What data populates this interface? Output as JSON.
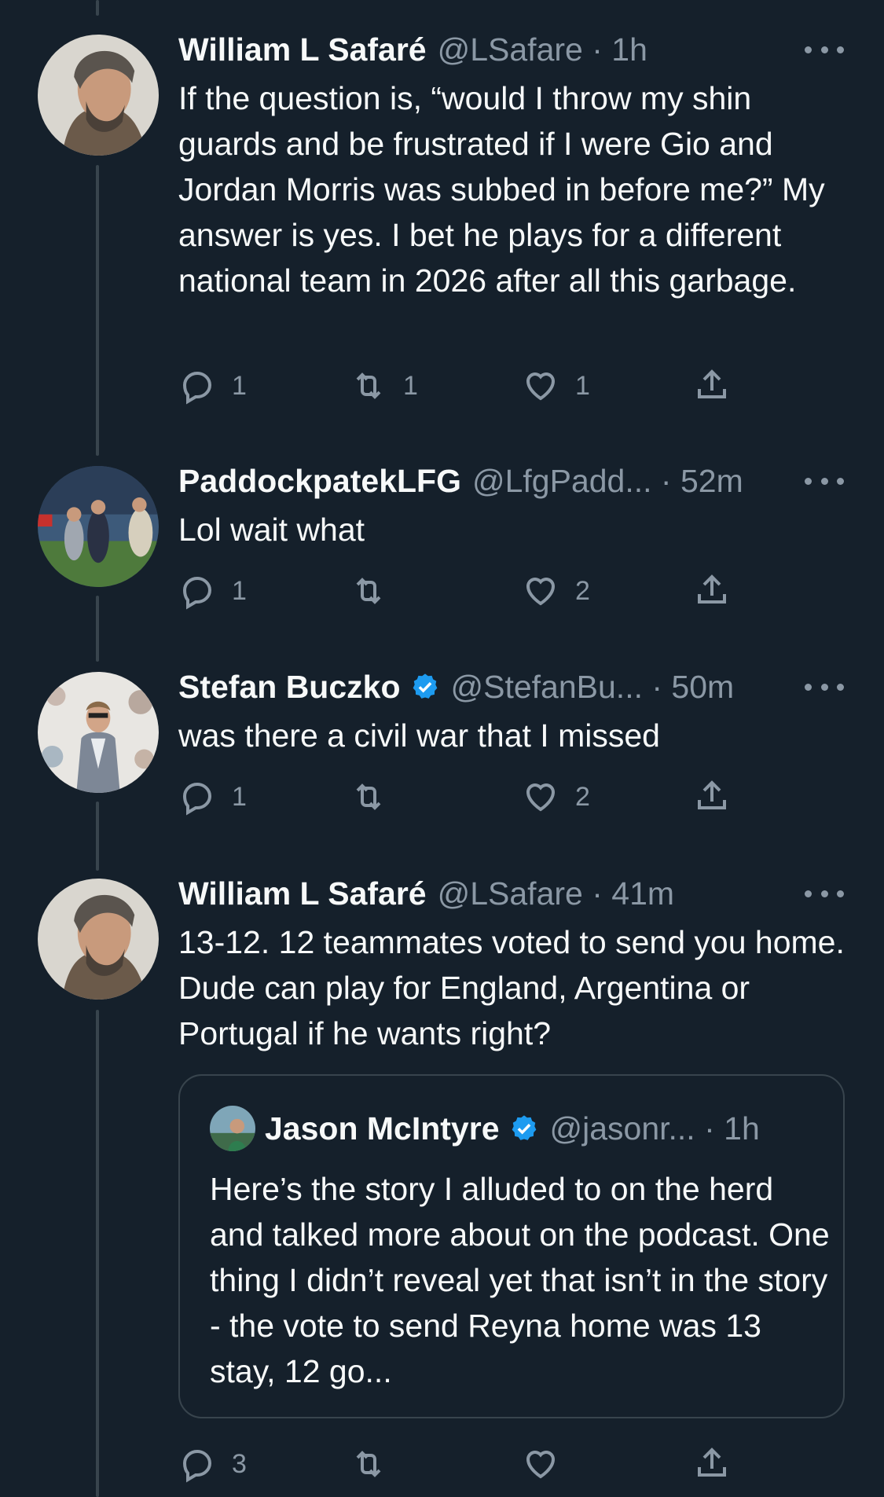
{
  "tweets": [
    {
      "name": "William L Safaré",
      "handle": "@LSafare · 1h",
      "text": "If the question is, “would I throw my shin guards and be frustrated if I were Gio and Jordan Morris was subbed in before me?” My answer is yes. I bet he plays for a different national team in 2026 after all this garbage.",
      "replies": "1",
      "retweets": "1",
      "likes": "1"
    },
    {
      "name": "PaddockpatekLFG",
      "handle": "@LfgPadd... · 52m",
      "text": "Lol wait what",
      "replies": "1",
      "retweets": "",
      "likes": "2"
    },
    {
      "name": "Stefan Buczko",
      "handle": "@StefanBu... · 50m",
      "text": "was there a civil war that I missed",
      "replies": "1",
      "retweets": "",
      "likes": "2"
    },
    {
      "name": "William L Safaré",
      "handle": "@LSafare · 41m",
      "text": "13-12. 12 teammates voted to send you home. Dude can play for England, Argentina or Portugal if he wants right?",
      "replies": "3",
      "retweets": "",
      "likes": "",
      "quote": {
        "name": "Jason McIntyre",
        "handle": "@jasonr... · 1h",
        "text": "Here’s the story I alluded to on the herd and talked more about on the podcast. One thing I didn’t reveal yet that isn’t in the story - the vote to send Reyna home was 13 stay, 12 go..."
      }
    }
  ],
  "colors": {
    "background": "#15202b",
    "text": "#f7f9f9",
    "muted": "#8b98a5",
    "verified": "#1d9bf0",
    "line": "#38444d"
  }
}
